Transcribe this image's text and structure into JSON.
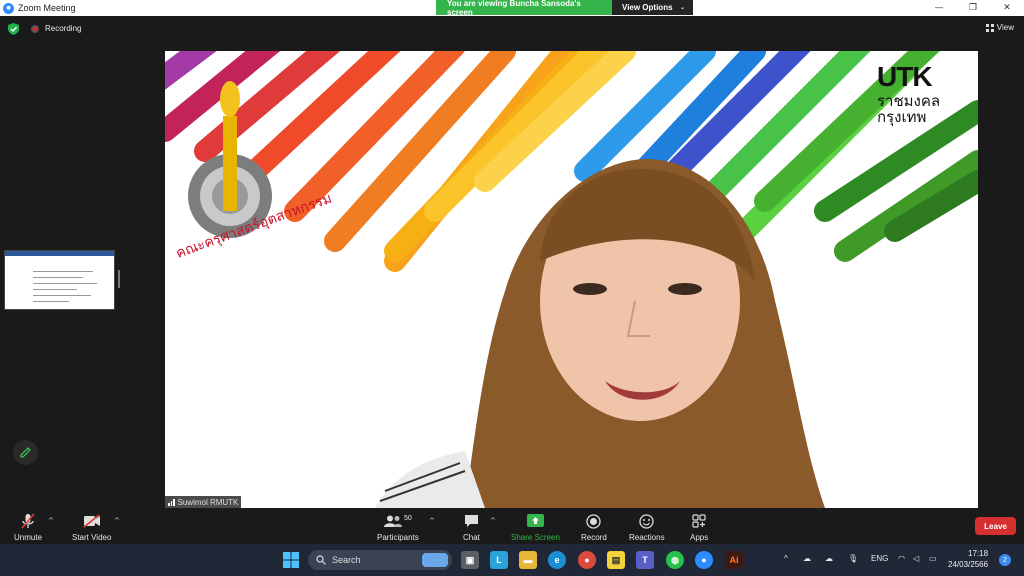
{
  "window": {
    "title": "Zoom Meeting"
  },
  "banner": {
    "message": "You are viewing Buncha Sansoda's screen",
    "options_label": "View Options"
  },
  "meeting": {
    "recording_label": "Recording",
    "view_label": "View"
  },
  "speaker": {
    "name": "Suwimol RMUTK"
  },
  "logo": {
    "brand": "UTK",
    "line1": "ราชมงคล",
    "line2": "กรุงเทพ"
  },
  "toolbar": {
    "unmute": "Unmute",
    "start_video": "Start Video",
    "participants": "Participants",
    "participants_count": "50",
    "chat": "Chat",
    "share_screen": "Share Screen",
    "record": "Record",
    "reactions": "Reactions",
    "apps": "Apps",
    "leave": "Leave"
  },
  "taskbar": {
    "search_placeholder": "Search",
    "language": "ENG",
    "time": "17:18",
    "date": "24/03/2566",
    "notifications": "2"
  },
  "colors": {
    "share_green": "#34b44a",
    "leave_red": "#d3302f",
    "zoom_blue": "#2d8cff"
  }
}
